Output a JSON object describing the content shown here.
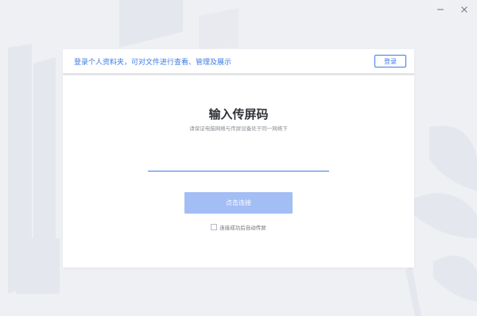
{
  "window": {
    "controls": {
      "minimize_icon": "minimize-icon",
      "close_icon": "close-icon"
    }
  },
  "banner": {
    "text": "登录个人资料夹，可对文件进行查看、管理及展示",
    "login_label": "登录"
  },
  "main": {
    "title": "输入传屏码",
    "subtitle": "请保证电脑网络与传屏设备处于同一网络下",
    "code_value": "",
    "connect_label": "点击连接",
    "auto_label": "连接成功后自动传屏",
    "auto_checked": false
  },
  "colors": {
    "accent": "#3d7be6",
    "button_disabled": "#a3bdf5",
    "background": "#eef0f4"
  }
}
